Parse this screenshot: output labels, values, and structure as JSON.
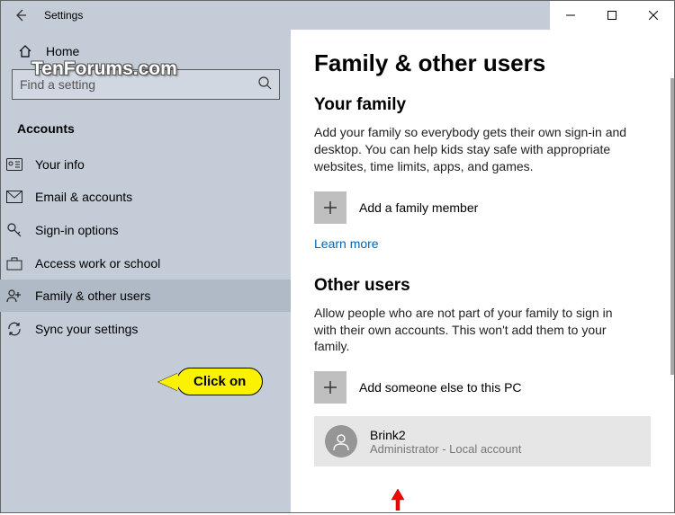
{
  "window": {
    "title": "Settings"
  },
  "sidebar": {
    "home_label": "Home",
    "search_placeholder": "Find a setting",
    "category": "Accounts",
    "items": [
      {
        "label": "Your info"
      },
      {
        "label": "Email & accounts"
      },
      {
        "label": "Sign-in options"
      },
      {
        "label": "Access work or school"
      },
      {
        "label": "Family & other users"
      },
      {
        "label": "Sync your settings"
      }
    ]
  },
  "main": {
    "page_title": "Family & other users",
    "family": {
      "heading": "Your family",
      "description": "Add your family so everybody gets their own sign-in and desktop. You can help kids stay safe with appropriate websites, time limits, apps, and games.",
      "add_label": "Add a family member",
      "learn_more": "Learn more"
    },
    "other": {
      "heading": "Other users",
      "description": "Allow people who are not part of your family to sign in with their own accounts. This won't add them to your family.",
      "add_label": "Add someone else to this PC",
      "user": {
        "name": "Brink2",
        "role": "Administrator - Local account"
      }
    }
  },
  "annotations": {
    "watermark": "TenForums.com",
    "callout": "Click on"
  }
}
